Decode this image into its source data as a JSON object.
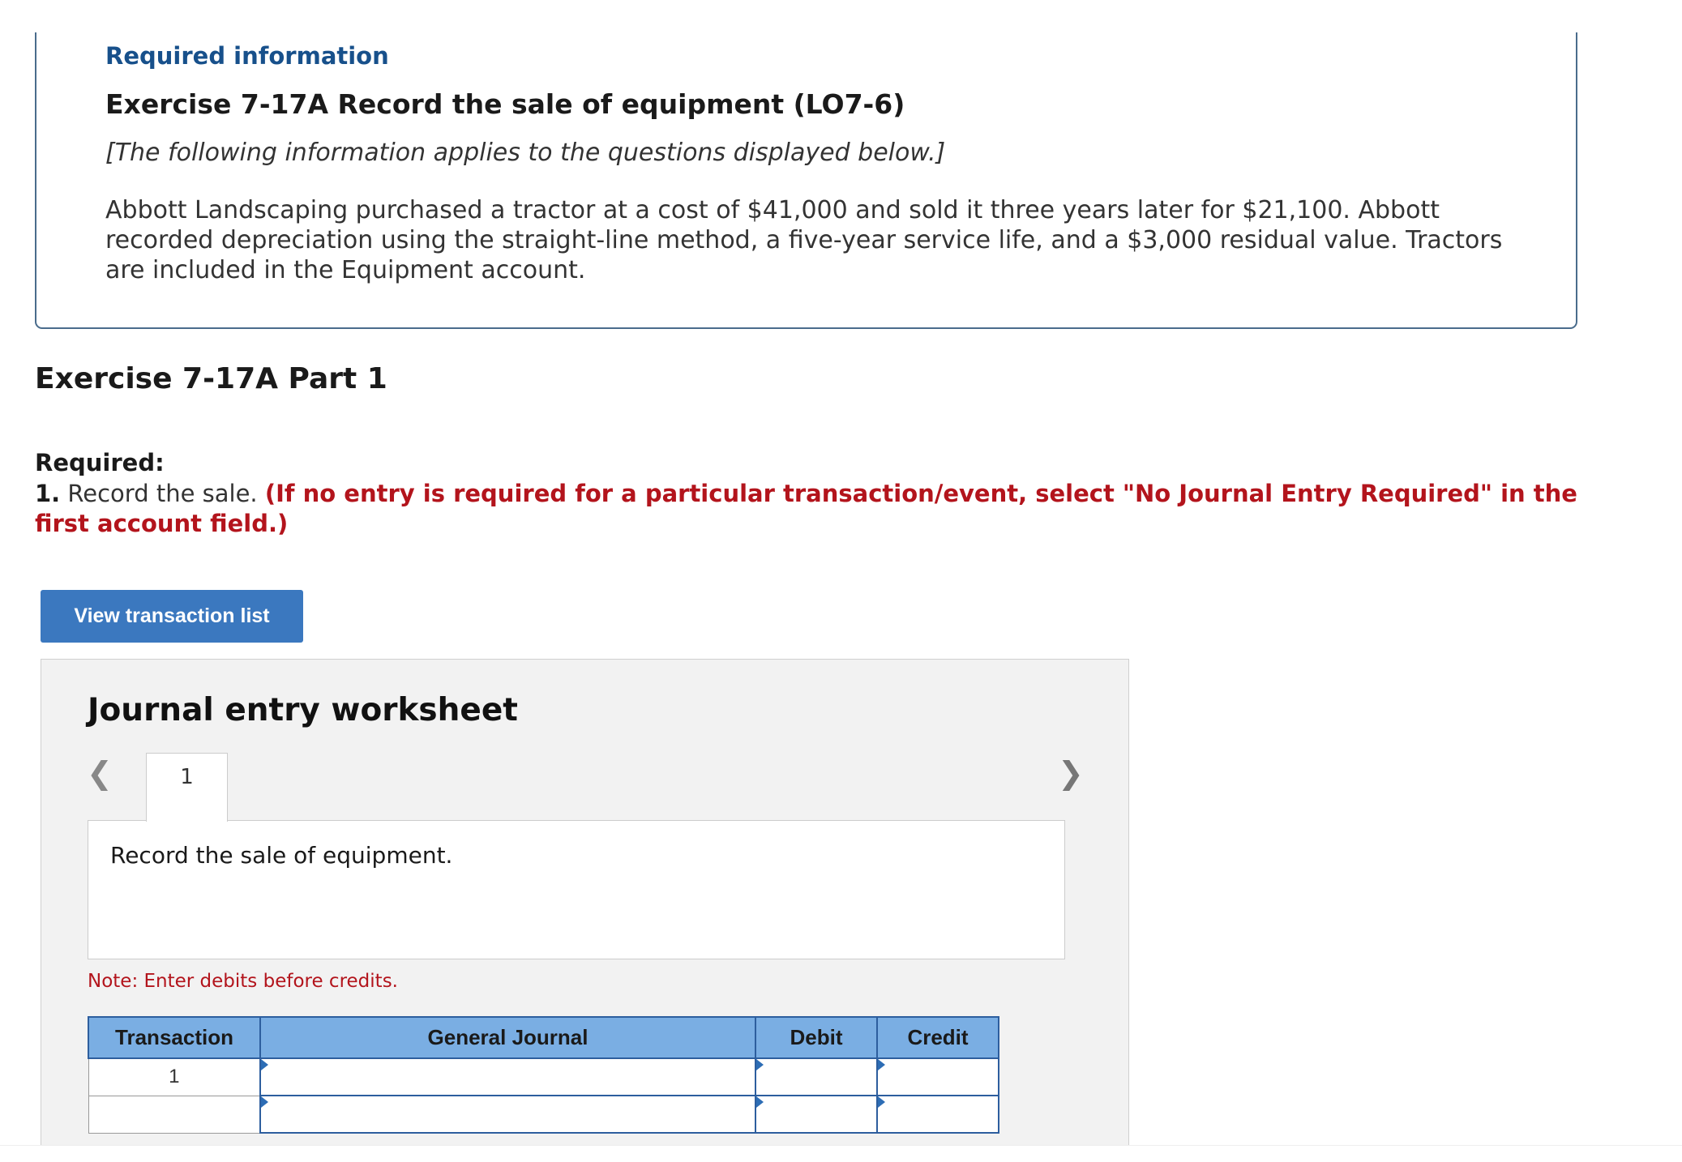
{
  "info": {
    "heading": "Required information",
    "exercise_title": "Exercise 7-17A Record the sale of equipment (LO7-6)",
    "applies_note": "[The following information applies to the questions displayed below.]",
    "body": "Abbott Landscaping purchased a tractor at a cost of $41,000 and sold it three years later for $21,100. Abbott recorded depreciation using the straight-line method, a five-year service life, and a $3,000 residual value. Tractors are included in the Equipment account."
  },
  "part": {
    "title": "Exercise 7-17A Part 1",
    "required_label": "Required:",
    "instruction_number": "1.",
    "instruction_text": "Record the sale.",
    "instruction_note": "(If no entry is required for a particular transaction/event, select \"No Journal Entry Required\" in the first account field.)"
  },
  "view_button": {
    "label": "View transaction list",
    "color": "#3b78bf"
  },
  "worksheet": {
    "title": "Journal entry worksheet",
    "tabs": [
      "1"
    ],
    "description": "Record the sale of equipment.",
    "note": "Note: Enter debits before credits.",
    "columns": [
      "Transaction",
      "General Journal",
      "Debit",
      "Credit"
    ],
    "rows": [
      {
        "transaction": "1"
      },
      {
        "transaction": ""
      }
    ],
    "header_color": "#7aaee3",
    "note_color": "#b3141c"
  }
}
